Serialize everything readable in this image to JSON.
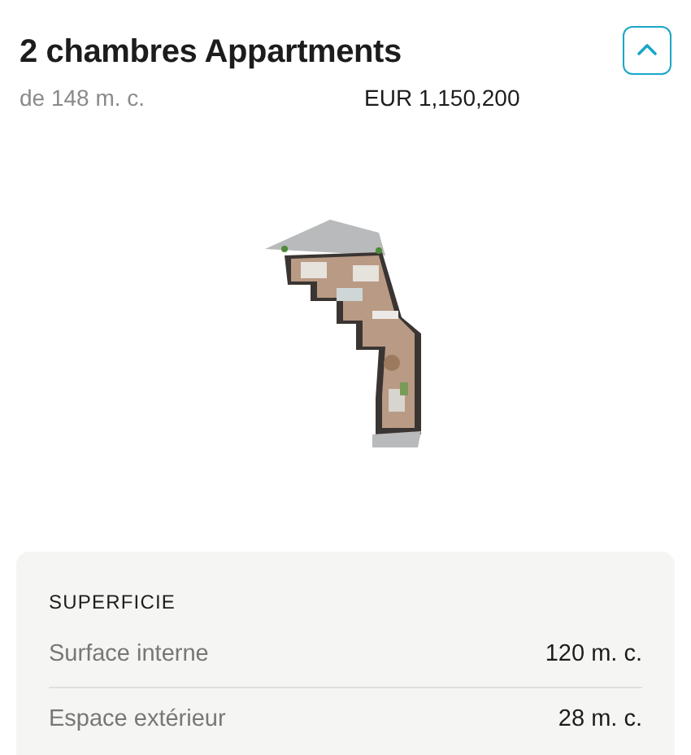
{
  "header": {
    "title": "2 chambres Appartments",
    "expanded": true
  },
  "summary": {
    "size": "de 148 m. c.",
    "price": "EUR 1,150,200"
  },
  "area_card": {
    "heading": "SUPERFICIE",
    "rows": [
      {
        "label": "Surface interne",
        "value": "120 m. c."
      },
      {
        "label": "Espace extérieur",
        "value": "28 m. c."
      }
    ]
  }
}
